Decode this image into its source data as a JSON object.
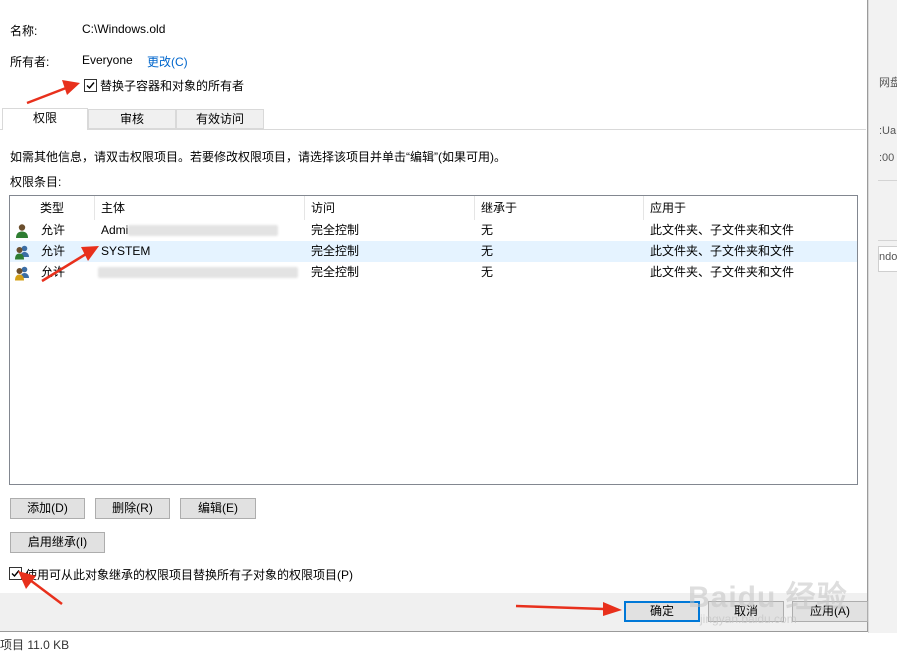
{
  "dialog": {
    "name_label": "名称:",
    "name_value": "C:\\Windows.old",
    "owner_label": "所有者:",
    "owner_value": "Everyone",
    "owner_change": "更改(C)",
    "replace_owner_label": "替换子容器和对象的所有者",
    "replace_owner_checked": true,
    "tabs": [
      {
        "label": "权限",
        "active": true
      },
      {
        "label": "审核",
        "active": false
      },
      {
        "label": "有效访问",
        "active": false
      }
    ],
    "info_text": "如需其他信息，请双击权限项目。若要修改权限项目，请选择该项目并单击“编辑”(如果可用)。",
    "entries_label": "权限条目:",
    "columns": [
      "类型",
      "主体",
      "访问",
      "继承于",
      "应用于"
    ],
    "rows": [
      {
        "type": "允许",
        "principal": "Admi",
        "access": "完全控制",
        "inherited": "无",
        "applies": "此文件夹、子文件夹和文件",
        "selected": false
      },
      {
        "type": "允许",
        "principal": "SYSTEM",
        "access": "完全控制",
        "inherited": "无",
        "applies": "此文件夹、子文件夹和文件",
        "selected": true
      },
      {
        "type": "允许",
        "principal": "",
        "access": "完全控制",
        "inherited": "无",
        "applies": "此文件夹、子文件夹和文件",
        "selected": false
      }
    ],
    "buttons": {
      "add": "添加(D)",
      "remove": "删除(R)",
      "edit": "编辑(E)",
      "enable_inheritance": "启用继承(I)"
    },
    "replace_child_label": "使用可从此对象继承的权限项目替换所有子对象的权限项目(P)",
    "replace_child_checked": true,
    "footer": {
      "ok": "确定",
      "cancel": "取消",
      "apply": "应用(A)"
    }
  },
  "background": {
    "status_text": "项目  11.0 KB",
    "right_fragments": [
      "网盘",
      ":Ua",
      ":00",
      "ndo"
    ]
  },
  "watermark": {
    "text": "Baidu 经验",
    "sub": "jingyan.baidu.com"
  },
  "colors": {
    "accent": "#0078d7",
    "link": "#0066cc",
    "selected_row": "#e5f3ff",
    "arrow": "#e8301c"
  }
}
